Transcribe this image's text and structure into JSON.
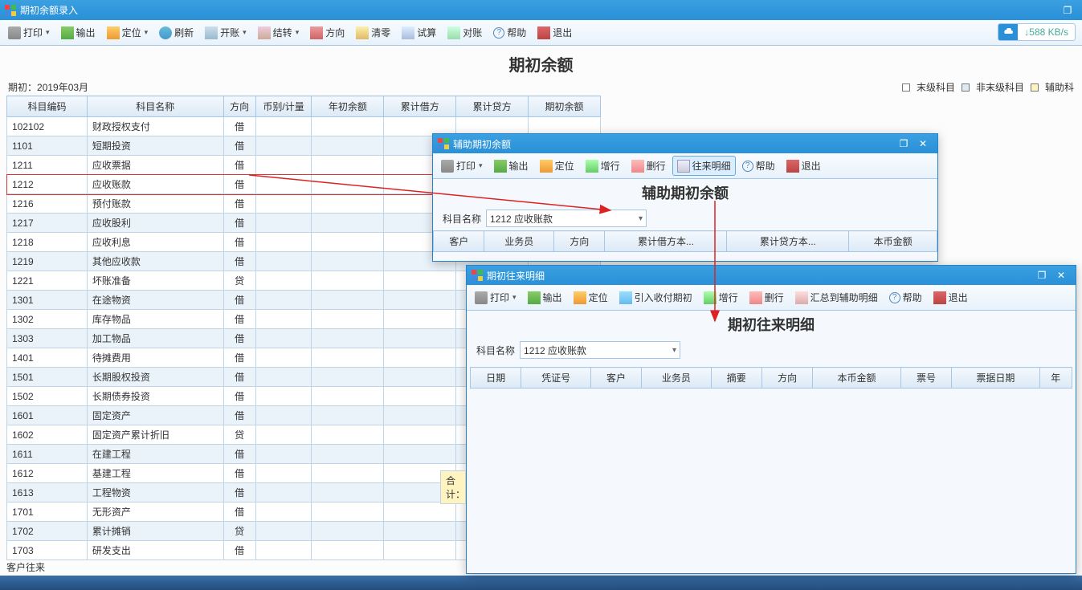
{
  "main": {
    "title": "期初余额录入",
    "toolbar": [
      "打印",
      "输出",
      "定位",
      "刷新",
      "开账",
      "结转",
      "方向",
      "清零",
      "试算",
      "对账",
      "帮助",
      "退出"
    ],
    "net_speed": "588 KB/s",
    "page_title": "期初余额",
    "period_label": "期初：",
    "period_value": "2019年03月",
    "legend": [
      "末级科目",
      "非末级科目",
      "辅助科"
    ],
    "columns": [
      "科目编码",
      "科目名称",
      "方向",
      "币别/计量",
      "年初余额",
      "累计借方",
      "累计贷方",
      "期初余额"
    ],
    "rows": [
      {
        "code": "102102",
        "name": "财政授权支付",
        "dir": "借"
      },
      {
        "code": "1101",
        "name": "短期投资",
        "dir": "借"
      },
      {
        "code": "1211",
        "name": "应收票据",
        "dir": "借"
      },
      {
        "code": "1212",
        "name": "应收账款",
        "dir": "借",
        "hl": true
      },
      {
        "code": "1216",
        "name": "预付账款",
        "dir": "借"
      },
      {
        "code": "1217",
        "name": "应收股利",
        "dir": "借"
      },
      {
        "code": "1218",
        "name": "应收利息",
        "dir": "借"
      },
      {
        "code": "1219",
        "name": "其他应收款",
        "dir": "借"
      },
      {
        "code": "1221",
        "name": "坏账准备",
        "dir": "贷"
      },
      {
        "code": "1301",
        "name": "在途物资",
        "dir": "借"
      },
      {
        "code": "1302",
        "name": "库存物品",
        "dir": "借"
      },
      {
        "code": "1303",
        "name": "加工物品",
        "dir": "借"
      },
      {
        "code": "1401",
        "name": "待摊费用",
        "dir": "借"
      },
      {
        "code": "1501",
        "name": "长期股权投资",
        "dir": "借"
      },
      {
        "code": "1502",
        "name": "长期债券投资",
        "dir": "借"
      },
      {
        "code": "1601",
        "name": "固定资产",
        "dir": "借"
      },
      {
        "code": "1602",
        "name": "固定资产累计折旧",
        "dir": "贷"
      },
      {
        "code": "1611",
        "name": "在建工程",
        "dir": "借"
      },
      {
        "code": "1612",
        "name": "基建工程",
        "dir": "借"
      },
      {
        "code": "1613",
        "name": "工程物资",
        "dir": "借"
      },
      {
        "code": "1701",
        "name": "无形资产",
        "dir": "借"
      },
      {
        "code": "1702",
        "name": "累计摊销",
        "dir": "贷"
      },
      {
        "code": "1703",
        "name": "研发支出",
        "dir": "借"
      }
    ],
    "sum_label": "合计：",
    "status": "客户往来"
  },
  "sub1": {
    "title": "辅助期初余额",
    "toolbar": [
      "打印",
      "输出",
      "定位",
      "增行",
      "删行",
      "往来明细",
      "帮助",
      "退出"
    ],
    "page_title": "辅助期初余额",
    "field_label": "科目名称",
    "field_value": "1212 应收账款",
    "columns": [
      "客户",
      "业务员",
      "方向",
      "累计借方本...",
      "累计贷方本...",
      "本币金额"
    ]
  },
  "sub2": {
    "title": "期初往来明细",
    "toolbar": [
      "打印",
      "输出",
      "定位",
      "引入收付期初",
      "增行",
      "删行",
      "汇总到辅助明细",
      "帮助",
      "退出"
    ],
    "page_title": "期初往来明细",
    "field_label": "科目名称",
    "field_value": "1212 应收账款",
    "columns": [
      "日期",
      "凭证号",
      "客户",
      "业务员",
      "摘要",
      "方向",
      "本币金额",
      "票号",
      "票据日期",
      "年"
    ]
  }
}
